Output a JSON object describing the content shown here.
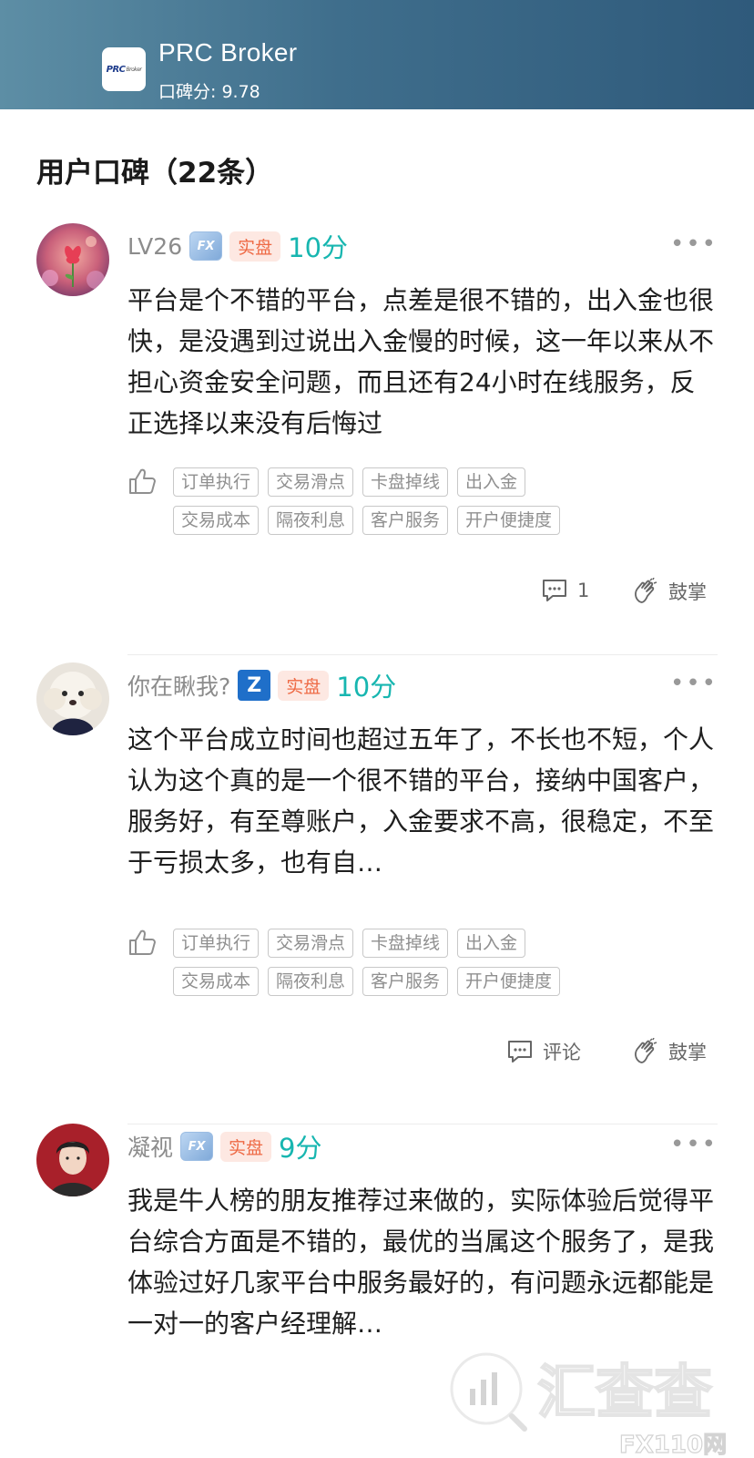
{
  "header": {
    "logo_text": "PRC",
    "logo_sub": "Broker",
    "name": "PRC Broker",
    "score": "口碑分: 9.78"
  },
  "section": {
    "title": "用户口碑（22条）"
  },
  "tag_labels": [
    "订单执行",
    "交易滑点",
    "卡盘掉线",
    "出入金",
    "交易成本",
    "隔夜利息",
    "客户服务",
    "开户便捷度"
  ],
  "reviews": [
    {
      "name": "LV26",
      "badge": "fx-icon",
      "account_tag": "实盘",
      "score": "10分",
      "content": "平台是个不错的平台，点差是很不错的，出入金也很快，是没遇到过说出入金慢的时候，这一年以来从不担心资金安全问题，而且还有24小时在线服务，反正选择以来没有后悔过",
      "comment_label": "1",
      "clap_label": "鼓掌"
    },
    {
      "name": "你在瞅我?",
      "badge": "z-icon",
      "account_tag": "实盘",
      "score": "10分",
      "content": "这个平台成立时间也超过五年了，不长也不短，个人认为这个真的是一个很不错的平台，接纳中国客户，服务好，有至尊账户，入金要求不高，很稳定，不至于亏损太多，也有自…",
      "comment_label": "评论",
      "clap_label": "鼓掌"
    },
    {
      "name": "凝视",
      "badge": "fx-icon",
      "account_tag": "实盘",
      "score": "9分",
      "content": "我是牛人榜的朋友推荐过来做的，实际体验后觉得平台综合方面是不错的，最优的当属这个服务了，是我体验过好几家平台中服务最好的，有问题永远都能是一对一的客户经理解…"
    }
  ],
  "watermark": {
    "brand": "汇查查",
    "site": "FX110网"
  },
  "colors": {
    "score": "#17b6b0",
    "real_tag_text": "#ee6a45",
    "real_tag_bg": "#fde8e2",
    "header_start": "#5d8ea5",
    "header_end": "#2f5a7b"
  }
}
